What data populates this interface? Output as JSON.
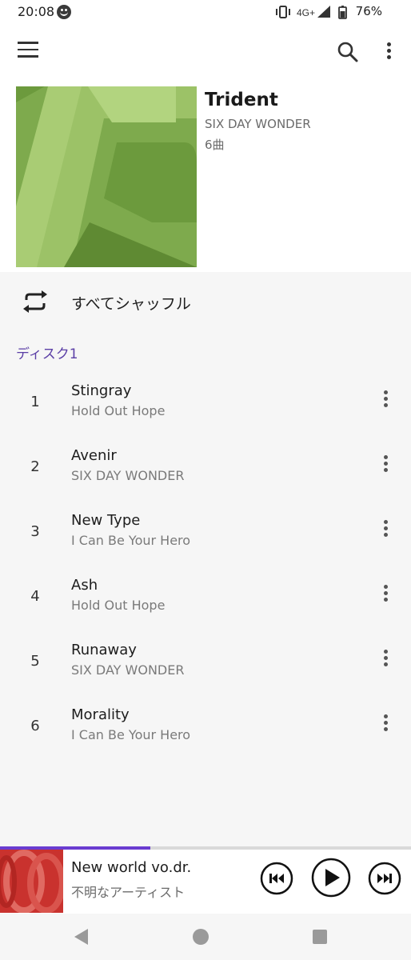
{
  "status_bar": {
    "time": "20:08",
    "network": "4G+",
    "battery": "76%"
  },
  "toolbar": {
    "menu_icon": "menu-icon",
    "search_icon": "search-icon",
    "overflow_icon": "more-vert-icon"
  },
  "album": {
    "title": "Trident",
    "artist": "SIX DAY WONDER",
    "track_count": "6曲",
    "art_colors": [
      "#7eaa4d",
      "#a9cc74",
      "#5f8a33"
    ]
  },
  "shuffle": {
    "label": "すべてシャッフル",
    "icon": "repeat-icon"
  },
  "disc": {
    "label": "ディスク1"
  },
  "tracks": [
    {
      "number": "1",
      "title": "Stingray",
      "subtitle": "Hold Out Hope"
    },
    {
      "number": "2",
      "title": "Avenir",
      "subtitle": "SIX DAY WONDER"
    },
    {
      "number": "3",
      "title": "New Type",
      "subtitle": "I Can Be Your Hero"
    },
    {
      "number": "4",
      "title": "Ash",
      "subtitle": "Hold Out Hope"
    },
    {
      "number": "5",
      "title": "Runaway",
      "subtitle": "SIX DAY WONDER"
    },
    {
      "number": "6",
      "title": "Morality",
      "subtitle": "I Can Be Your Hero"
    }
  ],
  "now_playing": {
    "title": "New world vo.dr.",
    "artist": "不明なアーティスト",
    "progress_fraction": 0.366,
    "accent_color": "#6a3cd0"
  },
  "nav": {
    "back_icon": "back-triangle-icon",
    "home_icon": "home-circle-icon",
    "recents_icon": "recents-square-icon"
  }
}
